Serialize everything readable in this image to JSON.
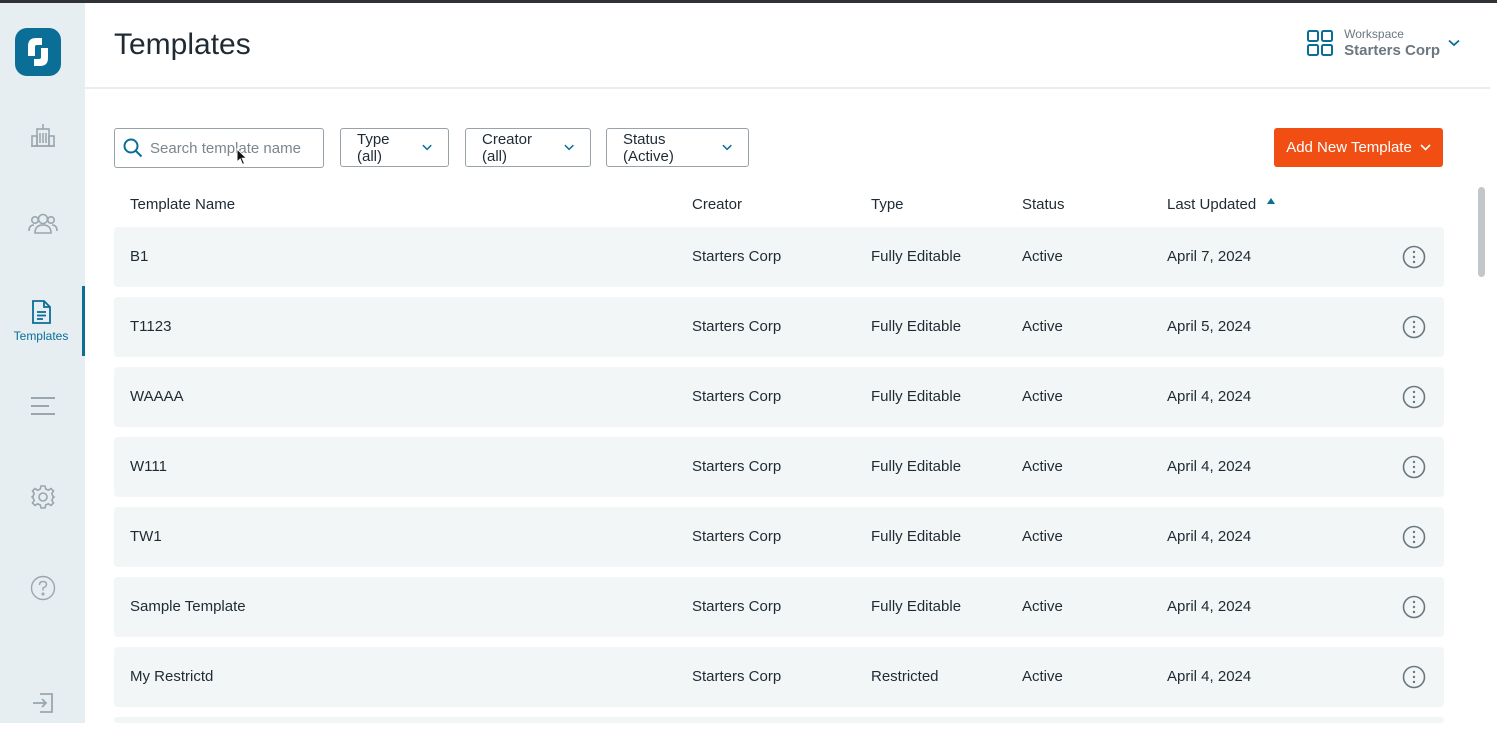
{
  "app": {
    "title": "Templates",
    "brand_color": "#0a6e97",
    "accent_color": "#f04e12"
  },
  "sidebar": {
    "items": [
      {
        "name": "buildings",
        "icon": "building-icon",
        "label": ""
      },
      {
        "name": "people",
        "icon": "people-icon",
        "label": ""
      },
      {
        "name": "templates",
        "icon": "document-icon",
        "label": "Templates",
        "active": true
      },
      {
        "name": "list",
        "icon": "lines-icon",
        "label": ""
      },
      {
        "name": "settings",
        "icon": "gear-icon",
        "label": ""
      },
      {
        "name": "help",
        "icon": "help-icon",
        "label": ""
      },
      {
        "name": "logout",
        "icon": "logout-icon",
        "label": ""
      }
    ]
  },
  "workspace": {
    "label": "Workspace",
    "name": "Starters Corp"
  },
  "toolbar": {
    "search_placeholder": "Search template name",
    "search_value": "",
    "type_filter": "Type (all)",
    "creator_filter": "Creator (all)",
    "status_filter": "Status (Active)",
    "add_button": "Add New Template"
  },
  "table": {
    "columns": [
      "Template Name",
      "Creator",
      "Type",
      "Status",
      "Last Updated"
    ],
    "sort": {
      "column": "Last Updated",
      "direction": "ascending-indicator"
    },
    "rows": [
      {
        "name": "B1",
        "creator": "Starters Corp",
        "type": "Fully Editable",
        "status": "Active",
        "updated": "April 7, 2024"
      },
      {
        "name": "T1123",
        "creator": "Starters Corp",
        "type": "Fully Editable",
        "status": "Active",
        "updated": "April 5, 2024"
      },
      {
        "name": "WAAAA",
        "creator": "Starters Corp",
        "type": "Fully Editable",
        "status": "Active",
        "updated": "April 4, 2024"
      },
      {
        "name": "W111",
        "creator": "Starters Corp",
        "type": "Fully Editable",
        "status": "Active",
        "updated": "April 4, 2024"
      },
      {
        "name": "TW1",
        "creator": "Starters Corp",
        "type": "Fully Editable",
        "status": "Active",
        "updated": "April 4, 2024"
      },
      {
        "name": "Sample Template",
        "creator": "Starters Corp",
        "type": "Fully Editable",
        "status": "Active",
        "updated": "April 4, 2024"
      },
      {
        "name": "My Restrictd",
        "creator": "Starters Corp",
        "type": "Restricted",
        "status": "Active",
        "updated": "April 4, 2024"
      }
    ]
  }
}
